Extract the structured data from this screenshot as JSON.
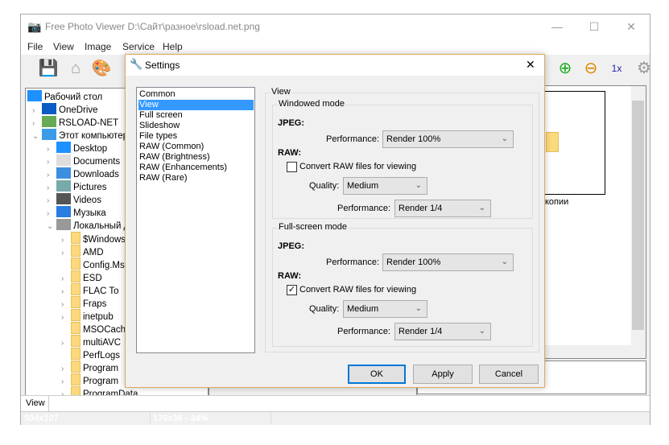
{
  "window": {
    "title": "Free Photo Viewer D:\\Сайт\\разное\\rsload.net.png",
    "minimize": "—",
    "maximize": "☐",
    "close": "✕"
  },
  "menu": [
    "File",
    "View",
    "Image",
    "Service",
    "Help"
  ],
  "tree": [
    {
      "label": "Рабочий стол",
      "level": 0,
      "icon": "desktop-icon"
    },
    {
      "label": "OneDrive",
      "level": 1,
      "icon": "onedrive-icon",
      "expander": "›"
    },
    {
      "label": "RSLOAD-NET",
      "level": 1,
      "icon": "user-icon",
      "expander": "›"
    },
    {
      "label": "Этот компьютер",
      "level": 1,
      "icon": "computer-icon",
      "expander": "⌄"
    },
    {
      "label": "Desktop",
      "level": 2,
      "icon": "desktop-icon",
      "expander": "›"
    },
    {
      "label": "Documents",
      "level": 2,
      "icon": "documents-icon",
      "expander": "›"
    },
    {
      "label": "Downloads",
      "level": 2,
      "icon": "downloads-icon",
      "expander": "›"
    },
    {
      "label": "Pictures",
      "level": 2,
      "icon": "pictures-icon",
      "expander": "›"
    },
    {
      "label": "Videos",
      "level": 2,
      "icon": "videos-icon",
      "expander": "›"
    },
    {
      "label": "Музыка",
      "level": 2,
      "icon": "music-icon",
      "expander": "›"
    },
    {
      "label": "Локальный диск",
      "level": 2,
      "icon": "drive-icon",
      "expander": "⌄"
    },
    {
      "label": "$Windows",
      "level": 3,
      "icon": "folder-icon",
      "expander": "›"
    },
    {
      "label": "AMD",
      "level": 3,
      "icon": "folder-icon",
      "expander": "›"
    },
    {
      "label": "Config.Msi",
      "level": 3,
      "icon": "folder-icon",
      "expander": ""
    },
    {
      "label": "ESD",
      "level": 3,
      "icon": "folder-icon",
      "expander": "›"
    },
    {
      "label": "FLAC To",
      "level": 3,
      "icon": "folder-icon",
      "expander": "›"
    },
    {
      "label": "Fraps",
      "level": 3,
      "icon": "folder-icon",
      "expander": "›"
    },
    {
      "label": "inetpub",
      "level": 3,
      "icon": "folder-icon",
      "expander": "›"
    },
    {
      "label": "MSOCache",
      "level": 3,
      "icon": "folder-icon",
      "expander": ""
    },
    {
      "label": "multiAVC",
      "level": 3,
      "icon": "folder-icon",
      "expander": "›"
    },
    {
      "label": "PerfLogs",
      "level": 3,
      "icon": "folder-icon",
      "expander": ""
    },
    {
      "label": "Program",
      "level": 3,
      "icon": "folder-icon",
      "expander": "›"
    },
    {
      "label": "Program",
      "level": 3,
      "icon": "folder-icon",
      "expander": "›"
    },
    {
      "label": "ProgramData",
      "level": 3,
      "icon": "folder-icon",
      "expander": "›"
    }
  ],
  "thumbs": {
    "caption": "копии"
  },
  "bottom_tab": "View",
  "status": {
    "image_size": "504x107",
    "thumb_info": "170x36 - 34%"
  },
  "dialog": {
    "title": "Settings",
    "close": "✕",
    "categories": [
      "Common",
      "View",
      "Full screen",
      "Slideshow",
      "File types",
      "RAW (Common)",
      "RAW (Brightness)",
      "RAW (Enhancements)",
      "RAW (Rare)"
    ],
    "selected_category": "View",
    "group_title": "View",
    "windowed": {
      "title": "Windowed mode",
      "jpeg_label": "JPEG:",
      "jpeg_perf_label": "Performance:",
      "jpeg_perf": "Render 100%",
      "raw_label": "RAW:",
      "convert_label": "Convert RAW files for viewing",
      "convert_checked": false,
      "quality_label": "Quality:",
      "quality": "Medium",
      "raw_perf_label": "Performance:",
      "raw_perf": "Render 1/4"
    },
    "fullscreen": {
      "title": "Full-screen mode",
      "jpeg_label": "JPEG:",
      "jpeg_perf_label": "Performance:",
      "jpeg_perf": "Render 100%",
      "raw_label": "RAW:",
      "convert_label": "Convert RAW files for viewing",
      "convert_checked": true,
      "quality_label": "Quality:",
      "quality": "Medium",
      "raw_perf_label": "Performance:",
      "raw_perf": "Render 1/4"
    },
    "buttons": {
      "ok": "OK",
      "apply": "Apply",
      "cancel": "Cancel"
    }
  }
}
